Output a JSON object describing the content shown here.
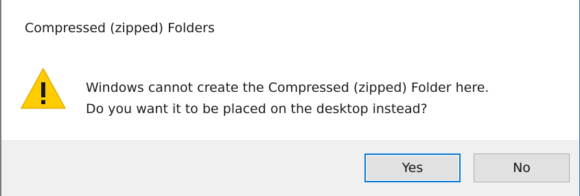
{
  "window": {
    "title": "Compressed (zipped) Folders"
  },
  "icon": {
    "name": "warning-icon",
    "fill": "#ffcc00",
    "glyph": "!"
  },
  "message": {
    "line1": "Windows cannot create the Compressed (zipped) Folder here.",
    "line2": "Do you want it to be placed on the desktop instead?"
  },
  "buttons": {
    "yes_label": "Yes",
    "no_label": "No"
  },
  "colors": {
    "accent": "#0078d7",
    "footer": "#f0f0f0"
  }
}
